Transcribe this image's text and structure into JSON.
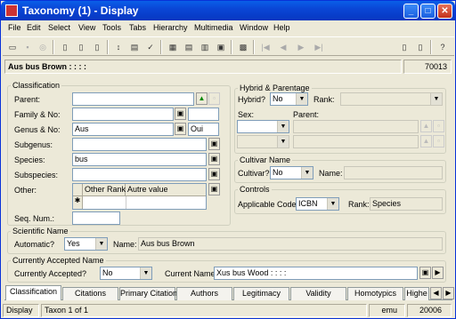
{
  "window": {
    "title": "Taxonomy (1) - Display",
    "min": "_",
    "max": "□",
    "close": "✕"
  },
  "menu": [
    "File",
    "Edit",
    "Select",
    "View",
    "Tools",
    "Tabs",
    "Hierarchy",
    "Multimedia",
    "Window",
    "Help"
  ],
  "record": {
    "summary": "Aus bus Brown : : : :",
    "id": "70013"
  },
  "classification": {
    "title": "Classification",
    "parent_label": "Parent:",
    "family_label": "Family & No:",
    "genus_label": "Genus & No:",
    "genus_value": "Aus",
    "genus_no": "Oui",
    "subgenus_label": "Subgenus:",
    "species_label": "Species:",
    "species_value": "bus",
    "subspecies_label": "Subspecies:",
    "other_label": "Other:",
    "other_cols": [
      "Other Rank",
      "Autre value"
    ],
    "new_row": "✱",
    "seq_label": "Seq. Num.:"
  },
  "hybrid": {
    "title": "Hybrid & Parentage",
    "hybrid_label": "Hybrid?",
    "hybrid_value": "No",
    "rank_label": "Rank:",
    "sex_label": "Sex:",
    "parent_label": "Parent:"
  },
  "cultivar": {
    "title": "Cultivar Name",
    "cultivar_label": "Cultivar?",
    "cultivar_value": "No",
    "name_label": "Name:"
  },
  "controls": {
    "title": "Controls",
    "code_label": "Applicable Code:",
    "code_value": "ICBN",
    "rank_label": "Rank:",
    "rank_value": "Species"
  },
  "scientific": {
    "title": "Scientific Name",
    "auto_label": "Automatic?",
    "auto_value": "Yes",
    "name_label": "Name:",
    "name_value": "Aus bus Brown"
  },
  "accepted": {
    "title": "Currently Accepted Name",
    "accepted_label": "Currently Accepted?",
    "accepted_value": "No",
    "current_label": "Current Name:",
    "current_value": "Xus bus Wood : : : :"
  },
  "tabs": [
    "Classification",
    "Citations",
    "Primary Citation",
    "Authors",
    "Legitimacy",
    "Validity",
    "Homotypics",
    "Highe"
  ],
  "status": {
    "mode": "Display",
    "position": "Taxon 1 of 1",
    "user": "emu",
    "id": "20006"
  }
}
